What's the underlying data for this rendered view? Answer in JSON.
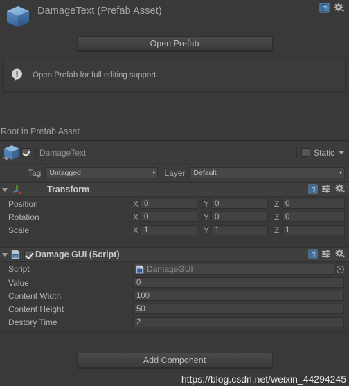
{
  "asset_header": {
    "title": "DamageText (Prefab Asset)",
    "icon": "prefab-cube-icon",
    "help_icon": "help-book-icon",
    "gear_icon": "gear-dropdown-icon"
  },
  "open_prefab": {
    "button_label": "Open Prefab",
    "info_icon": "info-exclamation-icon",
    "info_text": "Open Prefab for full editing support."
  },
  "root_section": {
    "label": "Root in Prefab Asset"
  },
  "game_object": {
    "icon": "prefab-cube-icon",
    "enabled": true,
    "name": "DamageText",
    "static_label": "Static",
    "static_checked": false,
    "tag_label": "Tag",
    "tag_value": "Untagged",
    "layer_label": "Layer",
    "layer_value": "Default"
  },
  "transform": {
    "title": "Transform",
    "icon": "transform-axis-icon",
    "expanded": true,
    "help_icon": "help-book-icon",
    "preset_icon": "preset-sliders-icon",
    "gear_icon": "gear-dropdown-icon",
    "axes": [
      "X",
      "Y",
      "Z"
    ],
    "rows": [
      {
        "label": "Position",
        "values": [
          "0",
          "0",
          "0"
        ]
      },
      {
        "label": "Rotation",
        "values": [
          "0",
          "0",
          "0"
        ]
      },
      {
        "label": "Scale",
        "values": [
          "1",
          "1",
          "1"
        ]
      }
    ]
  },
  "damage_gui": {
    "title": "Damage GUI (Script)",
    "icon": "csharp-script-icon",
    "enabled": true,
    "expanded": true,
    "help_icon": "help-book-icon",
    "preset_icon": "preset-sliders-icon",
    "gear_icon": "gear-dropdown-icon",
    "script_row": {
      "label": "Script",
      "value": "DamageGUI",
      "value_icon": "script-document-icon",
      "select_icon": "object-picker-icon"
    },
    "rows": [
      {
        "label": "Value",
        "value": "0"
      },
      {
        "label": "Content Width",
        "value": "100"
      },
      {
        "label": "Content Height",
        "value": "50"
      },
      {
        "label": "Destory Time",
        "value": "2"
      }
    ]
  },
  "footer": {
    "add_component_label": "Add Component",
    "watermark": "https://blog.csdn.net/weixin_44294245"
  },
  "colors": {
    "window_bg": "#393939",
    "header_bg": "#3c3c3c",
    "component_header_bg": "#3f3f3f",
    "field_bg": "#424242",
    "text": "#b4b4b4",
    "accent_blue": "#4a7ebb",
    "axis_green": "#73c91f",
    "axis_red": "#d42c1f",
    "axis_blue": "#2d8fd4"
  }
}
